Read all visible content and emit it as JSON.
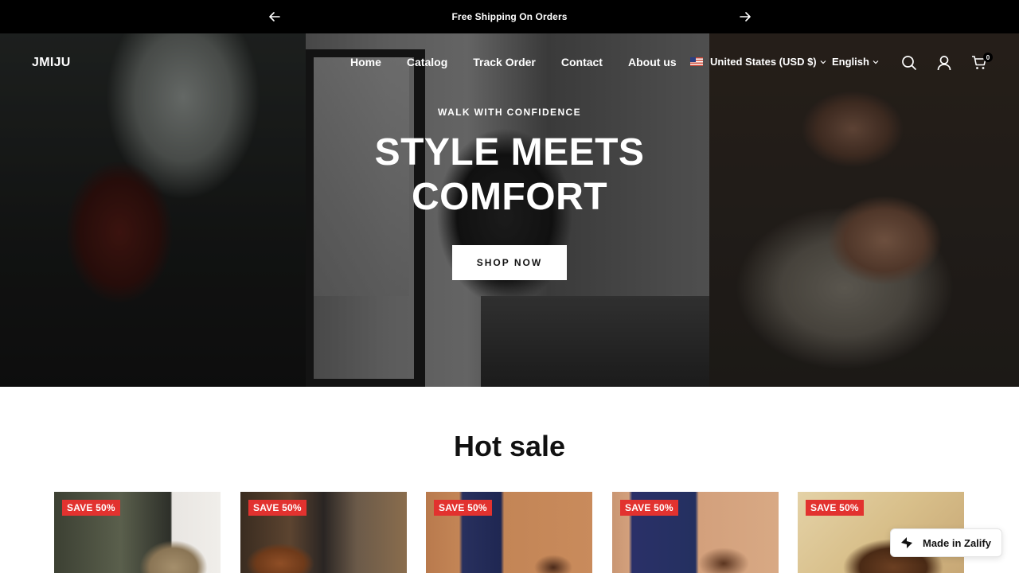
{
  "announcement": {
    "text": "Free Shipping On Orders",
    "prev_icon": "arrow-left-icon",
    "next_icon": "arrow-right-icon"
  },
  "header": {
    "logo": "JMIJU",
    "nav": [
      "Home",
      "Catalog",
      "Track Order",
      "Contact",
      "About us"
    ],
    "currency": "United States (USD $)",
    "language": "English",
    "icons": [
      "search-icon",
      "account-icon",
      "cart-icon"
    ],
    "cart_count": "0"
  },
  "hero": {
    "eyebrow": "WALK WITH CONFIDENCE",
    "title_line1": "STYLE MEETS",
    "title_line2": "COMFORT",
    "button": "SHOP NOW"
  },
  "hot_sale": {
    "title": "Hot sale",
    "products": [
      {
        "badge": "SAVE 50%"
      },
      {
        "badge": "SAVE 50%"
      },
      {
        "badge": "SAVE 50%"
      },
      {
        "badge": "SAVE 50%"
      },
      {
        "badge": "SAVE 50%"
      }
    ]
  },
  "zalify": {
    "label": "Made in Zalify"
  },
  "colors": {
    "announcement_bg": "#000000",
    "badge": "#e2322f",
    "button_bg": "#ffffff"
  }
}
